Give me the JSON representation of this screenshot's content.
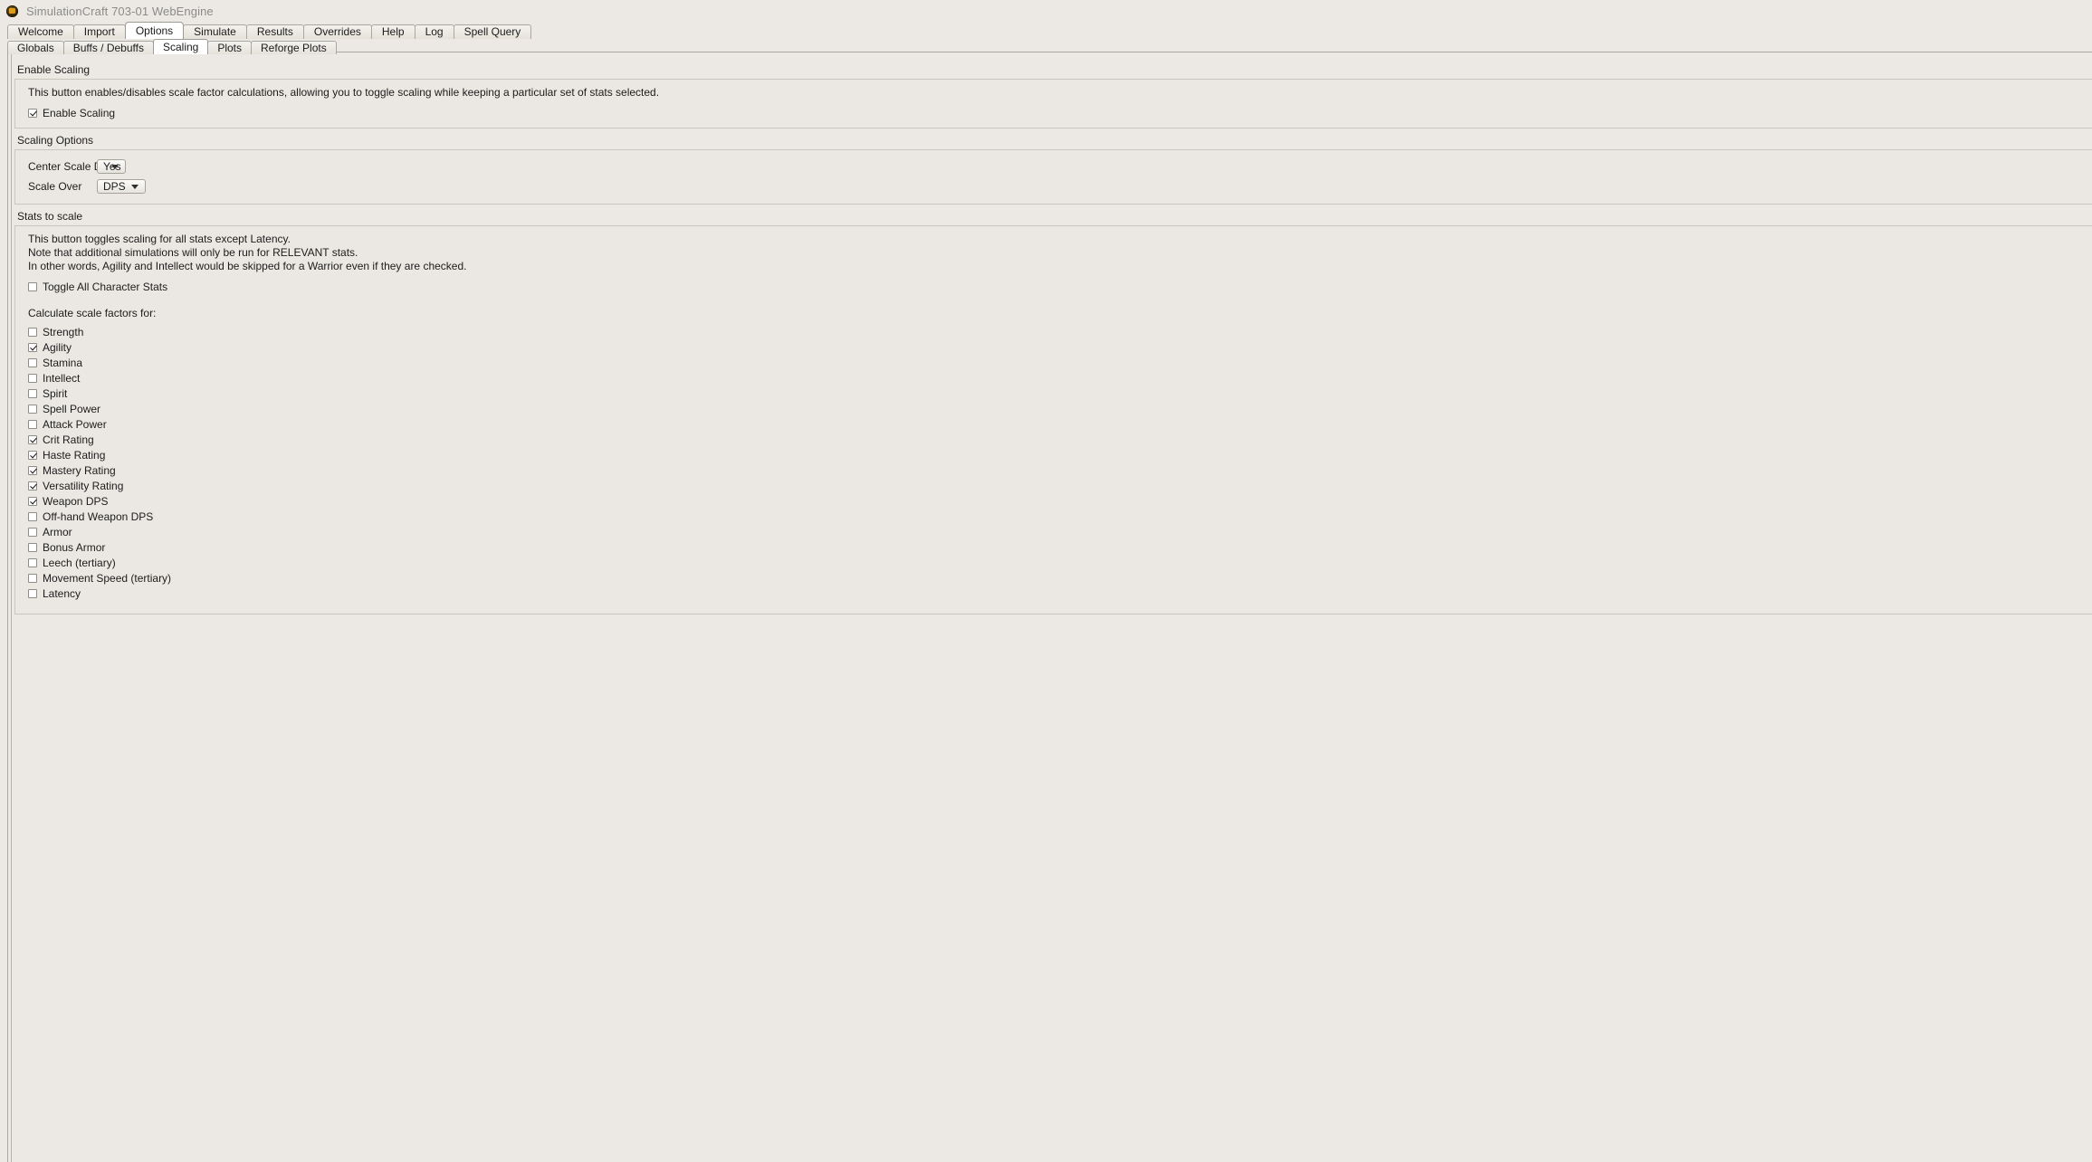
{
  "window": {
    "title": "SimulationCraft 703-01 WebEngine",
    "icon": "simulationcraft-icon"
  },
  "main_tabs": {
    "active": "Options",
    "items": [
      {
        "label": "Welcome"
      },
      {
        "label": "Import"
      },
      {
        "label": "Options"
      },
      {
        "label": "Simulate"
      },
      {
        "label": "Results"
      },
      {
        "label": "Overrides"
      },
      {
        "label": "Help"
      },
      {
        "label": "Log"
      },
      {
        "label": "Spell Query"
      }
    ]
  },
  "sub_tabs": {
    "active": "Scaling",
    "items": [
      {
        "label": "Globals"
      },
      {
        "label": "Buffs / Debuffs"
      },
      {
        "label": "Scaling"
      },
      {
        "label": "Plots"
      },
      {
        "label": "Reforge Plots"
      }
    ]
  },
  "enable_scaling": {
    "group_label": "Enable Scaling",
    "description": "This button enables/disables scale factor calculations, allowing you to toggle scaling while keeping a particular set of stats selected.",
    "checkbox": {
      "label": "Enable Scaling",
      "checked": true
    }
  },
  "scaling_options": {
    "group_label": "Scaling Options",
    "fields": [
      {
        "label": "Center Scale Delta",
        "value": "Yes",
        "size": "sm"
      },
      {
        "label": "Scale Over",
        "value": "DPS",
        "size": "lg"
      }
    ]
  },
  "stats_to_scale": {
    "group_label": "Stats to scale",
    "description_lines": [
      "This button toggles scaling for all stats except Latency.",
      "Note that additional simulations will only be run for RELEVANT stats.",
      "In other words, Agility and Intellect would be skipped for a Warrior even if they are checked."
    ],
    "toggle_all": {
      "label": "Toggle All Character Stats",
      "checked": false
    },
    "calculate_label": "Calculate scale factors for:",
    "stats": [
      {
        "label": "Strength",
        "checked": false
      },
      {
        "label": "Agility",
        "checked": true
      },
      {
        "label": "Stamina",
        "checked": false
      },
      {
        "label": "Intellect",
        "checked": false
      },
      {
        "label": "Spirit",
        "checked": false
      },
      {
        "label": "Spell Power",
        "checked": false
      },
      {
        "label": "Attack Power",
        "checked": false
      },
      {
        "label": "Crit Rating",
        "checked": true
      },
      {
        "label": "Haste Rating",
        "checked": true
      },
      {
        "label": "Mastery Rating",
        "checked": true
      },
      {
        "label": "Versatility Rating",
        "checked": true
      },
      {
        "label": "Weapon DPS",
        "checked": true
      },
      {
        "label": "Off-hand Weapon DPS",
        "checked": false
      },
      {
        "label": "Armor",
        "checked": false
      },
      {
        "label": "Bonus Armor",
        "checked": false
      },
      {
        "label": "Leech (tertiary)",
        "checked": false
      },
      {
        "label": "Movement Speed (tertiary)",
        "checked": false
      },
      {
        "label": "Latency",
        "checked": false
      }
    ]
  },
  "colors": {
    "window_bg": "#ece9e4",
    "group_bg": "#ebe8e3",
    "border": "#a9a79f",
    "active_tab": "#ffffff",
    "title_text": "#8b8b8b",
    "text": "#1c1c1c"
  }
}
